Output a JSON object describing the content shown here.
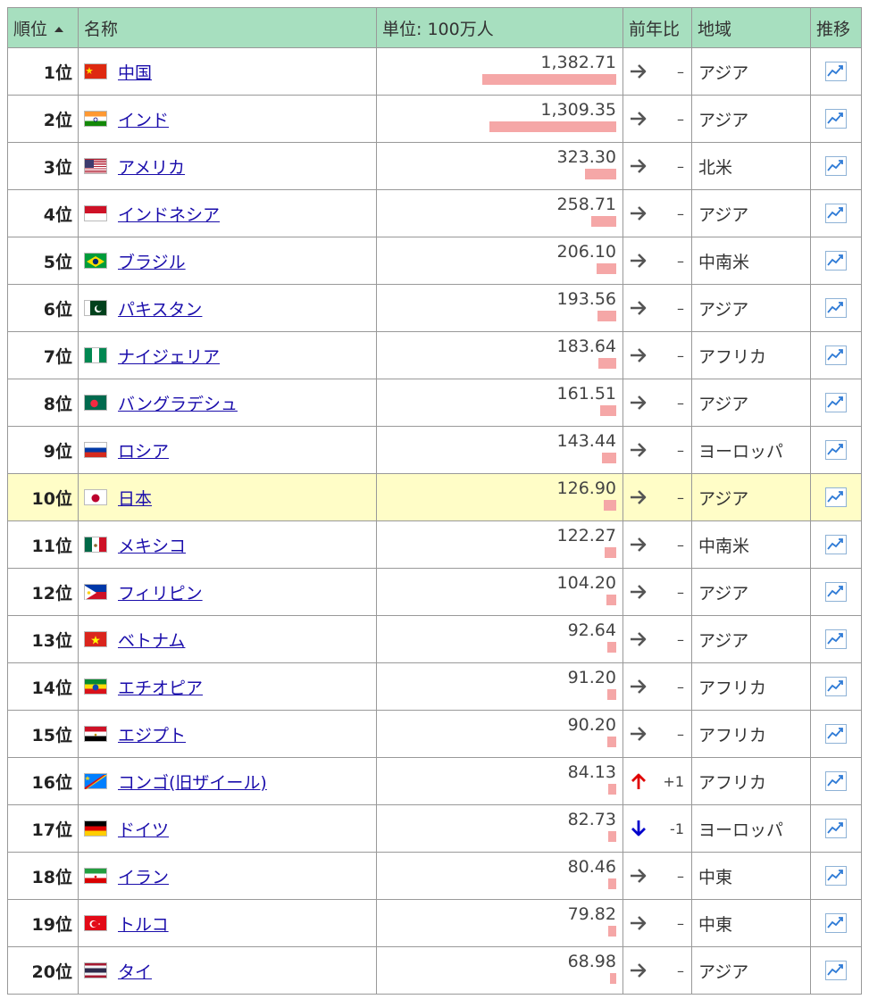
{
  "header": {
    "rank": "順位",
    "name": "名称",
    "value": "単位: 100万人",
    "change": "前年比",
    "region": "地域",
    "trend": "推移"
  },
  "colors": {
    "header_bg": "#a7dfbf",
    "highlight_row": "#fffdc7",
    "bar": "#f5a7a7",
    "link": "#1a0dab",
    "up": "#e00000",
    "down": "#0000cc"
  },
  "max_value": 1382.71,
  "rows": [
    {
      "rank": "1位",
      "name": "中国",
      "flag": "china-flag-icon",
      "value": "1,382.71",
      "num": 1382.71,
      "dir": "same",
      "change": "–",
      "region": "アジア"
    },
    {
      "rank": "2位",
      "name": "インド",
      "flag": "india-flag-icon",
      "value": "1,309.35",
      "num": 1309.35,
      "dir": "same",
      "change": "–",
      "region": "アジア"
    },
    {
      "rank": "3位",
      "name": "アメリカ",
      "flag": "usa-flag-icon",
      "value": "323.30",
      "num": 323.3,
      "dir": "same",
      "change": "–",
      "region": "北米"
    },
    {
      "rank": "4位",
      "name": "インドネシア",
      "flag": "indonesia-flag-icon",
      "value": "258.71",
      "num": 258.71,
      "dir": "same",
      "change": "–",
      "region": "アジア"
    },
    {
      "rank": "5位",
      "name": "ブラジル",
      "flag": "brazil-flag-icon",
      "value": "206.10",
      "num": 206.1,
      "dir": "same",
      "change": "–",
      "region": "中南米"
    },
    {
      "rank": "6位",
      "name": "パキスタン",
      "flag": "pakistan-flag-icon",
      "value": "193.56",
      "num": 193.56,
      "dir": "same",
      "change": "–",
      "region": "アジア"
    },
    {
      "rank": "7位",
      "name": "ナイジェリア",
      "flag": "nigeria-flag-icon",
      "value": "183.64",
      "num": 183.64,
      "dir": "same",
      "change": "–",
      "region": "アフリカ"
    },
    {
      "rank": "8位",
      "name": "バングラデシュ",
      "flag": "bangladesh-flag-icon",
      "value": "161.51",
      "num": 161.51,
      "dir": "same",
      "change": "–",
      "region": "アジア"
    },
    {
      "rank": "9位",
      "name": "ロシア",
      "flag": "russia-flag-icon",
      "value": "143.44",
      "num": 143.44,
      "dir": "same",
      "change": "–",
      "region": "ヨーロッパ"
    },
    {
      "rank": "10位",
      "name": "日本",
      "flag": "japan-flag-icon",
      "value": "126.90",
      "num": 126.9,
      "dir": "same",
      "change": "–",
      "region": "アジア",
      "highlight": true
    },
    {
      "rank": "11位",
      "name": "メキシコ",
      "flag": "mexico-flag-icon",
      "value": "122.27",
      "num": 122.27,
      "dir": "same",
      "change": "–",
      "region": "中南米"
    },
    {
      "rank": "12位",
      "name": "フィリピン",
      "flag": "philippines-flag-icon",
      "value": "104.20",
      "num": 104.2,
      "dir": "same",
      "change": "–",
      "region": "アジア"
    },
    {
      "rank": "13位",
      "name": "ベトナム",
      "flag": "vietnam-flag-icon",
      "value": "92.64",
      "num": 92.64,
      "dir": "same",
      "change": "–",
      "region": "アジア"
    },
    {
      "rank": "14位",
      "name": "エチオピア",
      "flag": "ethiopia-flag-icon",
      "value": "91.20",
      "num": 91.2,
      "dir": "same",
      "change": "–",
      "region": "アフリカ"
    },
    {
      "rank": "15位",
      "name": "エジプト",
      "flag": "egypt-flag-icon",
      "value": "90.20",
      "num": 90.2,
      "dir": "same",
      "change": "–",
      "region": "アフリカ"
    },
    {
      "rank": "16位",
      "name": "コンゴ(旧ザイール)",
      "flag": "dr-congo-flag-icon",
      "value": "84.13",
      "num": 84.13,
      "dir": "up",
      "change": "+1",
      "region": "アフリカ"
    },
    {
      "rank": "17位",
      "name": "ドイツ",
      "flag": "germany-flag-icon",
      "value": "82.73",
      "num": 82.73,
      "dir": "down",
      "change": "-1",
      "region": "ヨーロッパ"
    },
    {
      "rank": "18位",
      "name": "イラン",
      "flag": "iran-flag-icon",
      "value": "80.46",
      "num": 80.46,
      "dir": "same",
      "change": "–",
      "region": "中東"
    },
    {
      "rank": "19位",
      "name": "トルコ",
      "flag": "turkey-flag-icon",
      "value": "79.82",
      "num": 79.82,
      "dir": "same",
      "change": "–",
      "region": "中東"
    },
    {
      "rank": "20位",
      "name": "タイ",
      "flag": "thailand-flag-icon",
      "value": "68.98",
      "num": 68.98,
      "dir": "same",
      "change": "–",
      "region": "アジア"
    }
  ]
}
